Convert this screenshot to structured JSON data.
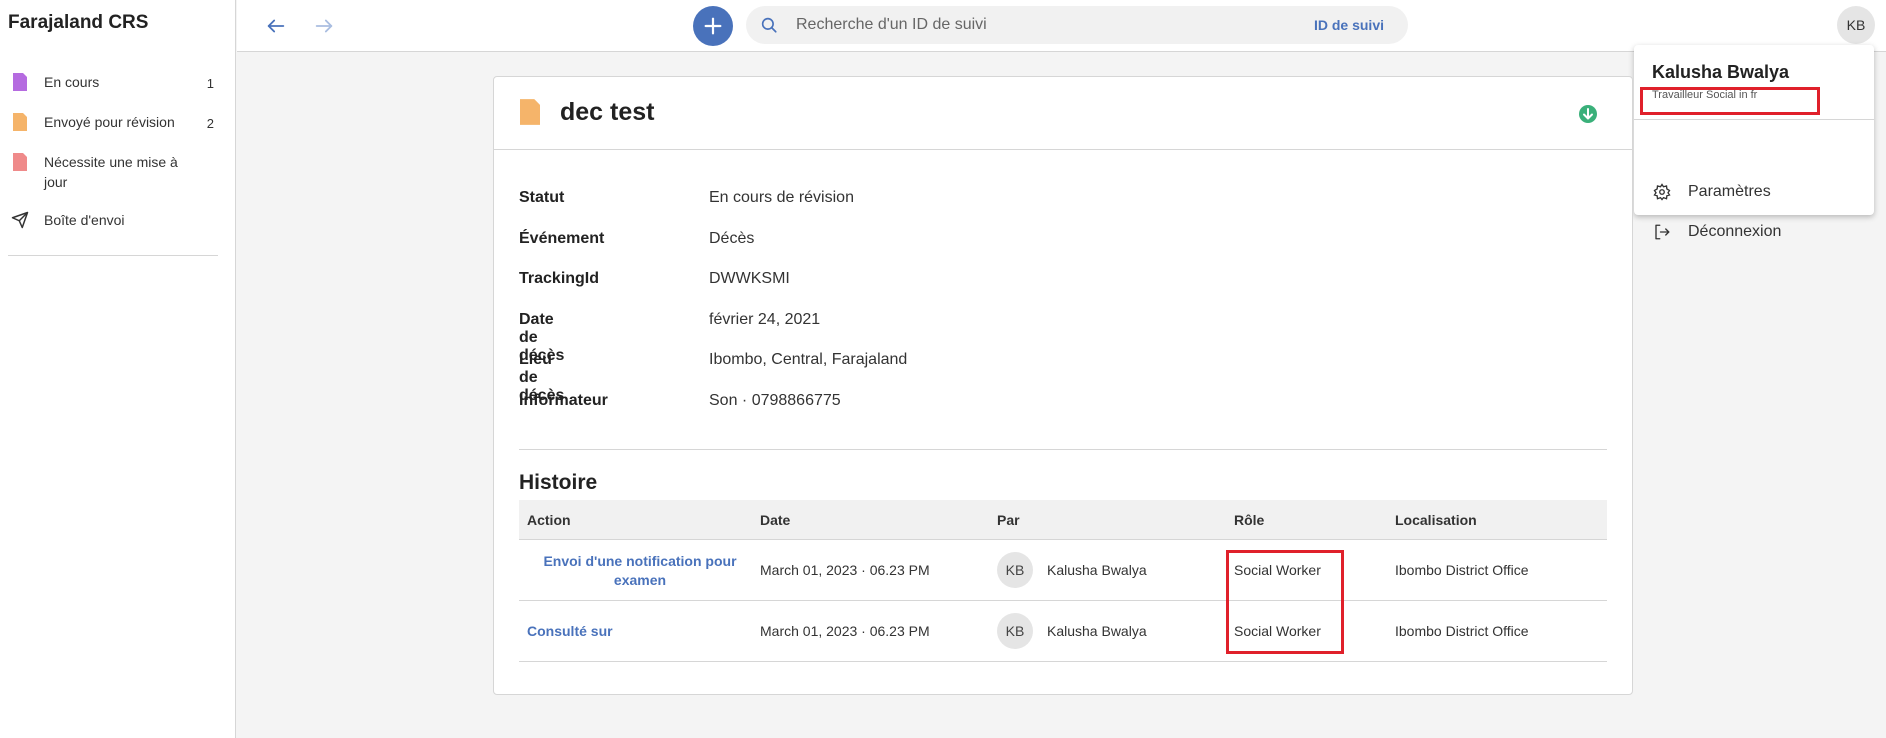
{
  "app": {
    "name": "Farajaland CRS"
  },
  "sidebar": {
    "items": [
      {
        "label": "En cours",
        "count": "1",
        "icon": "purple-doc-icon",
        "color": "#b56be0"
      },
      {
        "label": "Envoyé pour révision",
        "count": "2",
        "icon": "orange-doc-icon",
        "color": "#f5b46a"
      },
      {
        "label": "Nécessite une mise à jour",
        "count": "",
        "icon": "red-doc-icon",
        "color": "#ef8a8a"
      },
      {
        "label": "Boîte d'envoi",
        "count": "",
        "icon": "send-icon",
        "color": "#333333"
      }
    ]
  },
  "topbar": {
    "search_placeholder": "Recherche d'un ID de suivi",
    "search_type": "ID de suivi",
    "avatar_initials": "KB"
  },
  "user_menu": {
    "name": "Kalusha Bwalya",
    "role": "Travailleur Social in fr",
    "items": [
      {
        "label": "Paramètres",
        "icon": "gear-icon"
      },
      {
        "label": "Déconnexion",
        "icon": "logout-icon"
      }
    ]
  },
  "record": {
    "title": "dec test",
    "details": [
      {
        "label": "Statut",
        "value": "En cours de révision"
      },
      {
        "label": "Événement",
        "value": "Décès"
      },
      {
        "label": "TrackingId",
        "value": "DWWKSMI"
      },
      {
        "label": "Date de décès",
        "value": "février 24, 2021"
      },
      {
        "label": "Lieu de décès",
        "value": "Ibombo, Central, Farajaland"
      },
      {
        "label": "Informateur",
        "value": "Son · 0798866775"
      }
    ]
  },
  "history": {
    "title": "Histoire",
    "columns": [
      "Action",
      "Date",
      "Par",
      "Rôle",
      "Localisation"
    ],
    "rows": [
      {
        "action": "Envoi d'une notification pour examen",
        "date": "March 01, 2023 · 06.23 PM",
        "initials": "KB",
        "by": "Kalusha Bwalya",
        "role": "Social Worker",
        "location": "Ibombo District Office"
      },
      {
        "action": "Consulté sur",
        "date": "March 01, 2023 · 06.23 PM",
        "initials": "KB",
        "by": "Kalusha Bwalya",
        "role": "Social Worker",
        "location": "Ibombo District Office"
      }
    ]
  },
  "colors": {
    "accent": "#4972bb",
    "highlight": "#e0202a",
    "status_green": "#3ab07a"
  }
}
